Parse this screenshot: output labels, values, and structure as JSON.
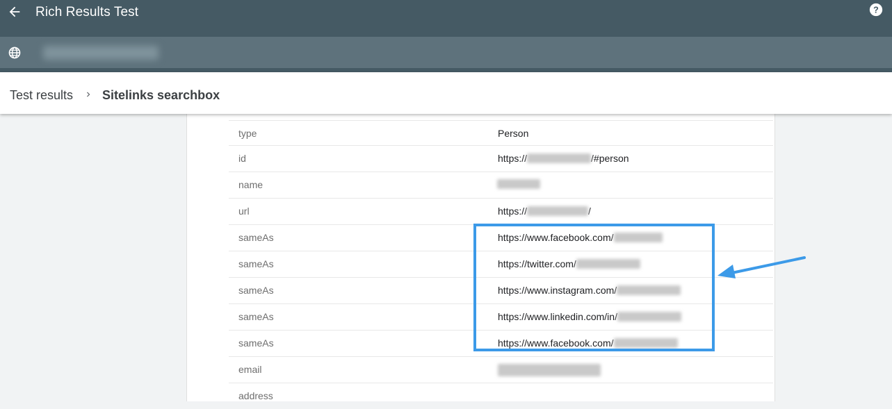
{
  "app": {
    "title": "Rich Results Test",
    "back_icon": "arrow-back-icon",
    "help_icon": "help-icon"
  },
  "url_bar": {
    "icon": "globe-icon",
    "url_value": ""
  },
  "breadcrumb": {
    "items": [
      "Test results",
      "Sitelinks searchbox"
    ]
  },
  "properties": [
    {
      "name": "type",
      "value": "Person"
    },
    {
      "name": "id",
      "prefix": "https://",
      "suffix": "/#person"
    },
    {
      "name": "name"
    },
    {
      "name": "url",
      "prefix": "https://",
      "suffix": "/"
    },
    {
      "name": "sameAs",
      "prefix": "https://www.facebook.com/"
    },
    {
      "name": "sameAs",
      "prefix": "https://twitter.com/"
    },
    {
      "name": "sameAs",
      "prefix": "https://www.instagram.com/"
    },
    {
      "name": "sameAs",
      "prefix": "https://www.linkedin.com/in/"
    },
    {
      "name": "sameAs",
      "prefix": "https://www.facebook.com/"
    },
    {
      "name": "email"
    },
    {
      "name": "address"
    }
  ],
  "colors": {
    "header": "#455a64",
    "url_bar": "#5e727c",
    "highlight": "#3c9ae8"
  }
}
